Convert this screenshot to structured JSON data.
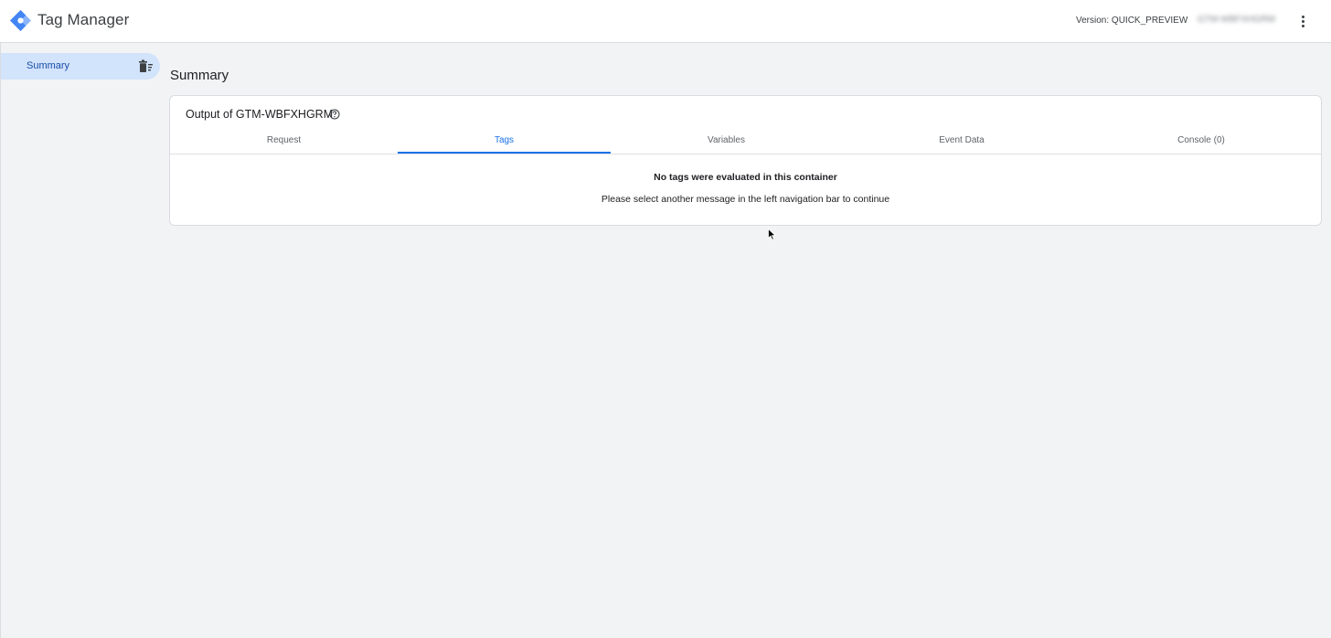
{
  "header": {
    "app_title": "Tag Manager",
    "version_label": "Version: QUICK_PREVIEW",
    "container_id_blurred": "GTM-WBFXHGRM"
  },
  "sidebar": {
    "items": [
      {
        "label": "Summary",
        "selected": true
      }
    ]
  },
  "main": {
    "page_title": "Summary",
    "card": {
      "title": "Output of GTM-WBFXHGRM",
      "tabs": [
        {
          "label": "Request"
        },
        {
          "label": "Tags",
          "active": true
        },
        {
          "label": "Variables"
        },
        {
          "label": "Event Data"
        },
        {
          "label": "Console (0)"
        }
      ],
      "empty_title": "No tags were evaluated in this container",
      "empty_subtitle": "Please select another message in the left navigation bar to continue"
    }
  },
  "colors": {
    "accent": "#1a73e8",
    "selected_bg": "#d2e3fc",
    "page_bg": "#f1f3f4"
  },
  "icons": [
    "tag-manager-logo-icon",
    "more-vert-icon",
    "delete-sweep-icon",
    "help-icon",
    "cursor-icon"
  ]
}
